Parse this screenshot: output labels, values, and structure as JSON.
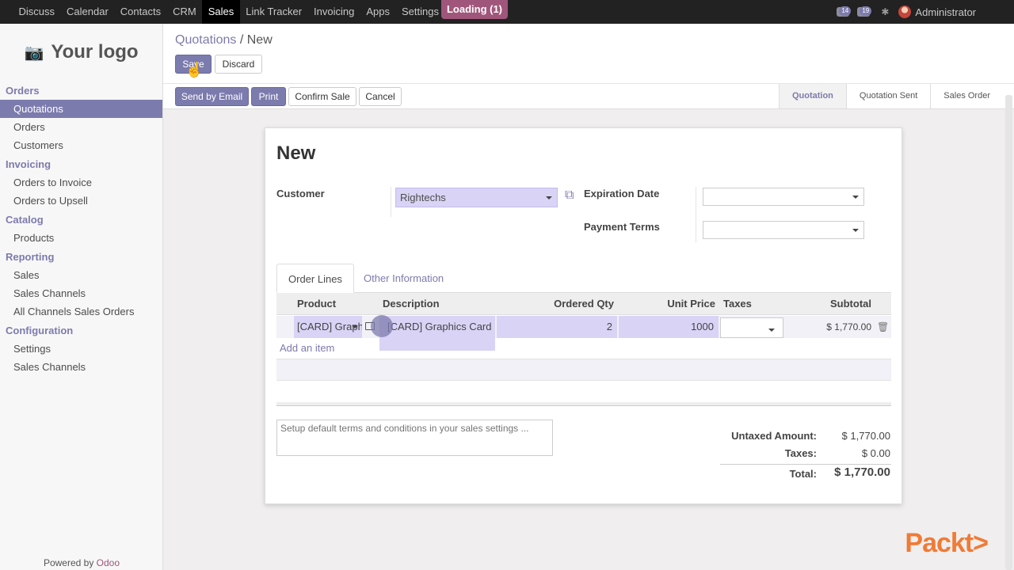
{
  "topbar": {
    "menu": [
      "Discuss",
      "Calendar",
      "Contacts",
      "CRM",
      "Sales",
      "Link Tracker",
      "Invoicing",
      "Apps",
      "Settings"
    ],
    "active": "Sales",
    "loading": "Loading (1)",
    "badge_messages": "14",
    "badge_activity": "19",
    "user": "Administrator"
  },
  "sidebar": {
    "logo_text": "Your logo",
    "sections": [
      {
        "title": "Orders",
        "items": [
          "Quotations",
          "Orders",
          "Customers"
        ]
      },
      {
        "title": "Invoicing",
        "items": [
          "Orders to Invoice",
          "Orders to Upsell"
        ]
      },
      {
        "title": "Catalog",
        "items": [
          "Products"
        ]
      },
      {
        "title": "Reporting",
        "items": [
          "Sales",
          "Sales Channels",
          "All Channels Sales Orders"
        ]
      },
      {
        "title": "Configuration",
        "items": [
          "Settings",
          "Sales Channels"
        ]
      }
    ],
    "active_item": "Quotations",
    "powered_prefix": "Powered by",
    "powered_brand": "Odoo"
  },
  "control": {
    "breadcrumb_parent": "Quotations",
    "breadcrumb_sep": "/",
    "breadcrumb_current": "New",
    "save_label": "Save",
    "discard_label": "Discard",
    "send_email_label": "Send by Email",
    "print_label": "Print",
    "confirm_label": "Confirm Sale",
    "cancel_label": "Cancel",
    "stages": [
      "Quotation",
      "Quotation Sent",
      "Sales Order"
    ],
    "active_stage": "Quotation"
  },
  "form": {
    "title": "New",
    "customer_label": "Customer",
    "customer_value": "Rightechs",
    "expiration_label": "Expiration Date",
    "expiration_value": "",
    "payment_terms_label": "Payment Terms",
    "payment_terms_value": "",
    "tabs": [
      "Order Lines",
      "Other Information"
    ],
    "columns": [
      "Product",
      "Description",
      "Ordered Qty",
      "Unit Price",
      "Taxes",
      "Subtotal"
    ],
    "line": {
      "product": "[CARD] Graphics Card",
      "description": "[CARD] Graphics Card",
      "qty": "2",
      "unit_price": "1000",
      "taxes": "",
      "subtotal": "$ 1,770.00"
    },
    "add_item": "Add an item",
    "notes_placeholder": "Setup default terms and conditions in your sales settings ...",
    "untaxed_label": "Untaxed Amount:",
    "untaxed_value": "$ 1,770.00",
    "taxes_label": "Taxes:",
    "taxes_value": "$ 0.00",
    "total_label": "Total:",
    "total_value": "$ 1,770.00"
  },
  "watermark": "Packt>",
  "colors": {
    "accent": "#7c7bad",
    "highlight": "#d9d3f5",
    "brand": "#a0567a",
    "packt": "#f07b36"
  }
}
